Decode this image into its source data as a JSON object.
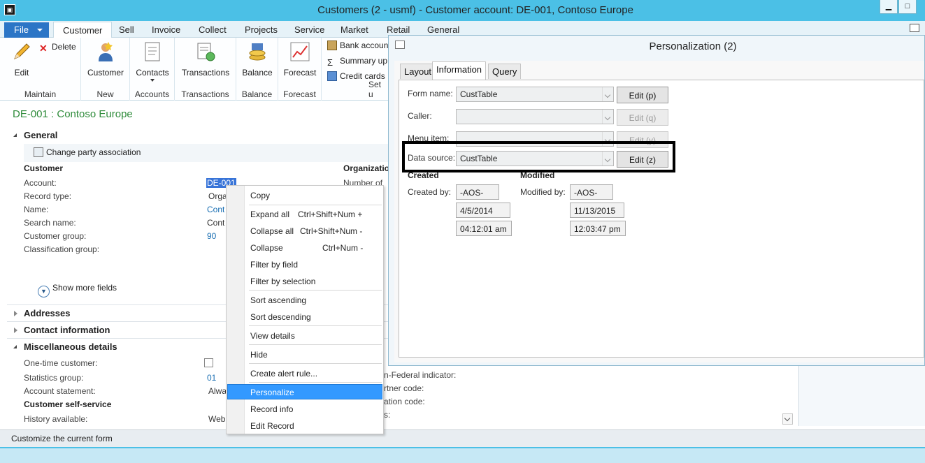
{
  "window": {
    "title": "Customers (2 - usmf) - Customer account: DE-001, Contoso Europe",
    "app_icon": "dynamics-ax-icon"
  },
  "ribbon": {
    "file_label": "File",
    "tabs": [
      "Customer",
      "Sell",
      "Invoice",
      "Collect",
      "Projects",
      "Service",
      "Market",
      "Retail",
      "General"
    ],
    "active_tab": "Customer",
    "groups": {
      "maintain": {
        "label": "Maintain",
        "edit": "Edit",
        "delete": "Delete"
      },
      "new": {
        "label": "New",
        "customer": "Customer"
      },
      "accounts": {
        "label": "Accounts",
        "contacts": "Contacts"
      },
      "transactions": {
        "label": "Transactions",
        "transactions": "Transactions"
      },
      "balance": {
        "label": "Balance",
        "balance": "Balance"
      },
      "forecast": {
        "label": "Forecast",
        "forecast": "Forecast"
      },
      "setup": {
        "label": "Set u",
        "bank_accounts": "Bank accoun",
        "summary_update": "Summary up",
        "credit_cards": "Credit cards"
      }
    }
  },
  "record": {
    "title": "DE-001 : Contoso Europe",
    "general": {
      "header": "General",
      "change_party": "Change party association",
      "customer_section": "Customer",
      "org_section": "Organizatio",
      "account_label": "Account:",
      "account_value": "DE-001",
      "record_type_label": "Record type:",
      "record_type_value": "Orga",
      "name_label": "Name:",
      "name_value": "Cont",
      "search_name_label": "Search name:",
      "search_name_value": "Cont",
      "customer_group_label": "Customer group:",
      "customer_group_value": "90",
      "classification_label": "Classification group:",
      "number_of_label": "Number of",
      "show_more": "Show more fields"
    },
    "addresses": "Addresses",
    "contact_information": "Contact information",
    "misc": {
      "header": "Miscellaneous details",
      "one_time_label": "One-time customer:",
      "statistics_group_label": "Statistics group:",
      "statistics_group_value": "01",
      "account_statement_label": "Account statement:",
      "account_statement_value": "Alwa",
      "self_service_section": "Customer self-service",
      "history_label": "History available:",
      "history_value": "Web",
      "non_federal_label": "n-Federal indicator:",
      "partner_code_label": "rtner code:",
      "ation_code_label": "ation code:",
      "s_label": "s:"
    }
  },
  "context_menu": {
    "items": [
      {
        "label": "Copy",
        "shortcut": ""
      },
      {
        "label": "Expand all",
        "shortcut": "Ctrl+Shift+Num +"
      },
      {
        "label": "Collapse all",
        "shortcut": "Ctrl+Shift+Num -"
      },
      {
        "label": "Collapse",
        "shortcut": "Ctrl+Num -"
      },
      {
        "label": "Filter by field",
        "shortcut": ""
      },
      {
        "label": "Filter by selection",
        "shortcut": ""
      },
      {
        "label": "Sort ascending",
        "shortcut": ""
      },
      {
        "label": "Sort descending",
        "shortcut": ""
      },
      {
        "label": "View details",
        "shortcut": ""
      },
      {
        "label": "Hide",
        "shortcut": ""
      },
      {
        "label": "Create alert rule...",
        "shortcut": ""
      },
      {
        "label": "Personalize",
        "shortcut": ""
      },
      {
        "label": "Record info",
        "shortcut": ""
      },
      {
        "label": "Edit Record",
        "shortcut": ""
      }
    ],
    "highlighted": "Personalize"
  },
  "dialog": {
    "title": "Personalization (2)",
    "tabs": [
      "Layout",
      "Information",
      "Query"
    ],
    "active_tab": "Information",
    "form_name_label": "Form name:",
    "form_name_value": "CustTable",
    "form_name_button": "Edit (p)",
    "caller_label": "Caller:",
    "caller_value": "",
    "caller_button": "Edit (q)",
    "menu_item_label": "Menu item:",
    "menu_item_value": "",
    "menu_item_button": "Edit (y)",
    "data_source_label": "Data source:",
    "data_source_value": "CustTable",
    "data_source_button": "Edit (z)",
    "created_section": "Created",
    "modified_section": "Modified",
    "created_by_label": "Created by:",
    "created_by_value": "-AOS-",
    "created_date": "4/5/2014",
    "created_time": "04:12:01 am",
    "modified_by_label": "Modified by:",
    "modified_by_value": "-AOS-",
    "modified_date": "11/13/2015",
    "modified_time": "12:03:47 pm"
  },
  "status": {
    "text": "Customize the current form"
  },
  "colors": {
    "title_bar": "#4bc0e6",
    "file_tab": "#2b75c6",
    "record_title": "#2e8b3a",
    "link": "#1a6fb3",
    "menu_highlight": "#3399ff"
  }
}
